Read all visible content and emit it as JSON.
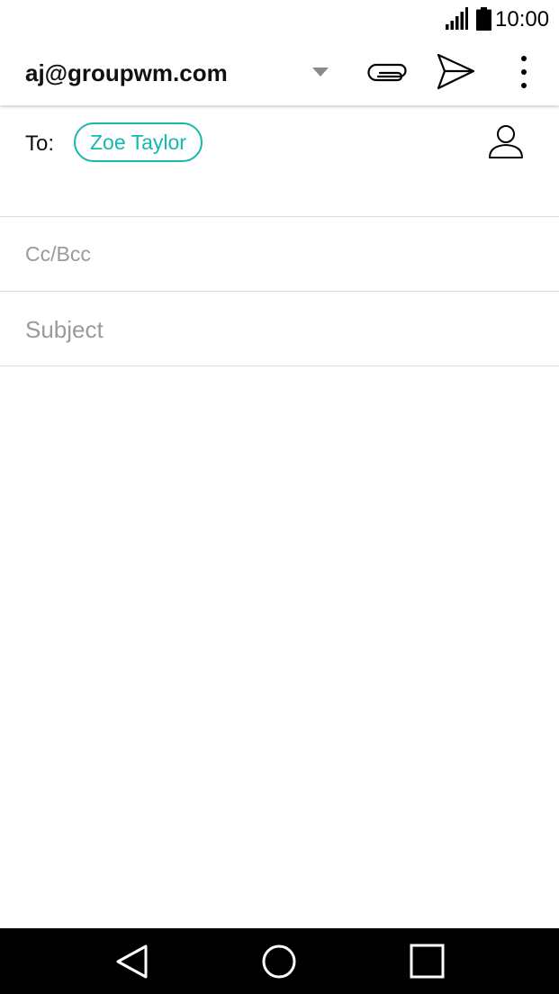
{
  "status_bar": {
    "time": "10:00",
    "signal_icon": "signal-icon",
    "battery_icon": "battery-icon"
  },
  "app_bar": {
    "account": "aj@groupwm.com",
    "icons": {
      "dropdown": "chevron-down-icon",
      "attach": "paperclip-icon",
      "send": "send-icon",
      "more": "more-vert-icon"
    }
  },
  "compose": {
    "to_label": "To:",
    "recipients": [
      {
        "name": "Zoe Taylor"
      }
    ],
    "contacts_icon": "person-icon",
    "cc_bcc_label": "Cc/Bcc",
    "subject_placeholder": "Subject",
    "subject_value": "",
    "body_value": ""
  },
  "nav_bar": {
    "back_icon": "back-icon",
    "home_icon": "home-icon",
    "recents_icon": "recents-icon"
  },
  "colors": {
    "accent": "#14b8ae",
    "hint": "#9a9a9a",
    "divider": "#dcdcdc",
    "nav_background": "#000000"
  }
}
